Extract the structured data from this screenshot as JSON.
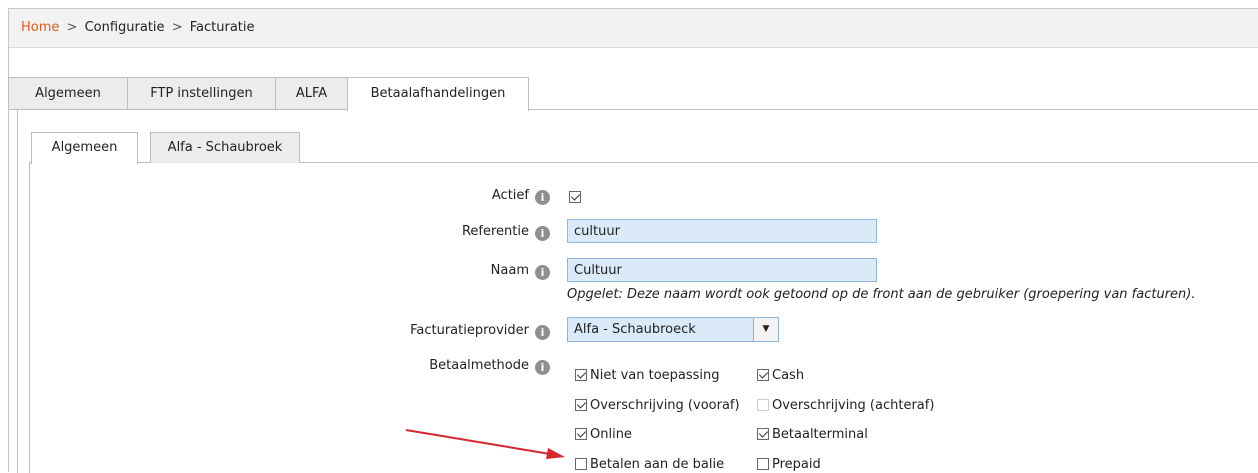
{
  "breadcrumb": {
    "home": "Home",
    "sep": ">",
    "item1": "Configuratie",
    "item2": "Facturatie"
  },
  "top_tabs": [
    "Algemeen",
    "FTP instellingen",
    "ALFA",
    "Betaalafhandelingen"
  ],
  "sub_tabs": [
    "Algemeen",
    "Alfa - Schaubroek"
  ],
  "form": {
    "actief": {
      "label": "Actief",
      "checked": true
    },
    "referentie": {
      "label": "Referentie",
      "value": "cultuur"
    },
    "naam": {
      "label": "Naam",
      "value": "Cultuur",
      "note": "Opgelet: Deze naam wordt ook getoond op de front aan de gebruiker (groepering van facturen)."
    },
    "provider": {
      "label": "Facturatieprovider",
      "value": "Alfa - Schaubroeck"
    },
    "betaalmethode": {
      "label": "Betaalmethode",
      "options": [
        {
          "label": "Niet van toepassing",
          "checked": true
        },
        {
          "label": "Cash",
          "checked": true
        },
        {
          "label": "Overschrijving (vooraf)",
          "checked": true
        },
        {
          "label": "Overschrijving (achteraf)",
          "checked": false,
          "disabled": true
        },
        {
          "label": "Online",
          "checked": true
        },
        {
          "label": "Betaalterminal",
          "checked": true
        },
        {
          "label": "Betalen aan de balie",
          "checked": false
        },
        {
          "label": "Prepaid",
          "checked": false
        }
      ]
    }
  },
  "icons": {
    "info": "info-icon",
    "check": "check-icon",
    "dropdown": "chevron-down-icon",
    "annotation": "red-arrow"
  },
  "colors": {
    "link": "#e05a1c",
    "input_bg": "#daeaf8",
    "arrow": "#d9262c"
  }
}
